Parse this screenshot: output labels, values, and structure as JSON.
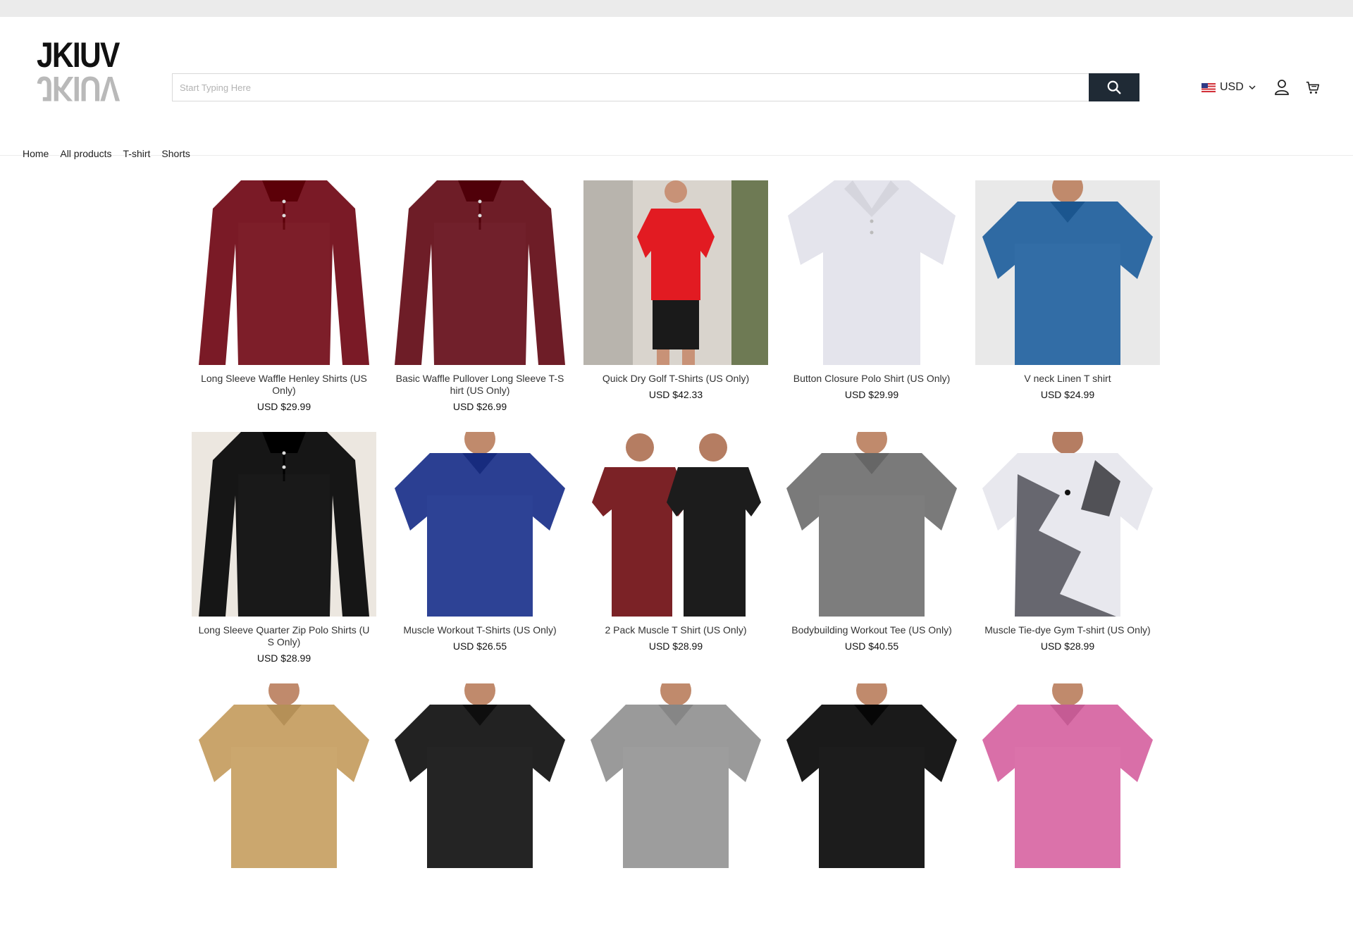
{
  "header": {
    "logo_text": "JKIUV",
    "search_placeholder": "Start Typing Here",
    "currency_label": "USD"
  },
  "nav": {
    "items": [
      "Home",
      "All products",
      "T-shirt",
      "Shorts"
    ]
  },
  "products": [
    {
      "title": "Long Sleeve Waffle Henley Shirts (US Only)",
      "price": "USD $29.99",
      "color": "#7a1a26",
      "bg": "#ffffff",
      "style": "longsleeve"
    },
    {
      "title": "Basic Waffle Pullover Long Sleeve T-Shirt (US Only)",
      "price": "USD $26.99",
      "color": "#6e1d27",
      "bg": "#ffffff",
      "style": "longsleeve"
    },
    {
      "title": "Quick Dry Golf T-Shirts (US Only)",
      "price": "USD $42.33",
      "color": "#e21b22",
      "bg": "#d9d4cd",
      "style": "photo"
    },
    {
      "title": "Button Closure Polo Shirt (US Only)",
      "price": "USD $29.99",
      "color": "#e4e4ec",
      "bg": "#ffffff",
      "style": "polo"
    },
    {
      "title": "V neck Linen T shirt",
      "price": "USD $24.99",
      "color": "#2f6aa3",
      "bg": "#e9e9e9",
      "style": "tee"
    },
    {
      "title": "Long Sleeve Quarter Zip Polo Shirts (US Only)",
      "price": "USD $28.99",
      "color": "#161616",
      "bg": "#ece7e0",
      "style": "longsleeve"
    },
    {
      "title": "Muscle Workout T-Shirts (US Only)",
      "price": "USD $26.55",
      "color": "#2b3f92",
      "bg": "#ffffff",
      "style": "tee"
    },
    {
      "title": "2 Pack Muscle T Shirt (US Only)",
      "price": "USD $28.99",
      "color": "#7b2226",
      "bg": "#ffffff",
      "style": "twopack"
    },
    {
      "title": "Bodybuilding Workout Tee (US Only)",
      "price": "USD $40.55",
      "color": "#7a7a7a",
      "bg": "#ffffff",
      "style": "tee"
    },
    {
      "title": "Muscle Tie-dye Gym T-shirt (US Only)",
      "price": "USD $28.99",
      "color": "#505058",
      "bg": "#ffffff",
      "style": "tiedye"
    }
  ],
  "partial_row_colors": [
    "#c9a46b",
    "#222222",
    "#9a9a9a",
    "#1a1a1a",
    "#d96fa8"
  ]
}
